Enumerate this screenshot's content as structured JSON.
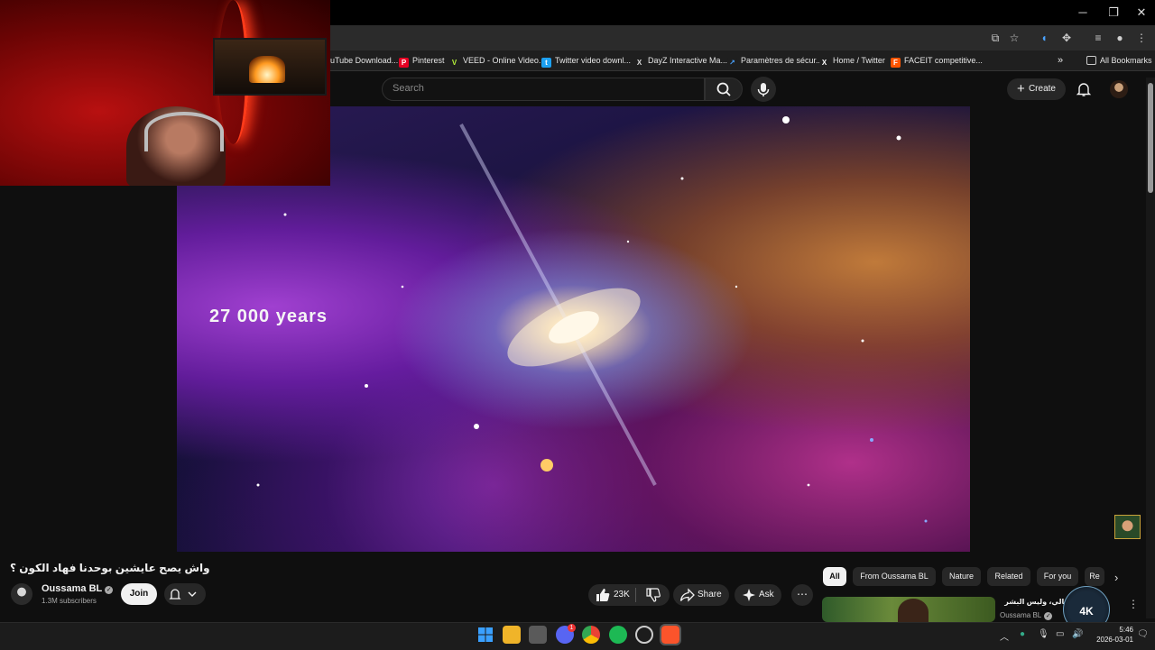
{
  "browser": {
    "window_controls": {
      "minimize": "─",
      "maximize": "❐",
      "close": "✕"
    },
    "bookmarks": [
      {
        "label": "uTube Download...",
        "icon_color": "#c00"
      },
      {
        "label": "Pinterest",
        "icon_color": "#e60023"
      },
      {
        "label": "VEED - Online Video...",
        "icon_color": "#b6f23a"
      },
      {
        "label": "Twitter video downl...",
        "icon_color": "#1da1f2"
      },
      {
        "label": "DayZ Interactive Ma...",
        "icon_color": "#333333"
      },
      {
        "label": "Paramètres de sécur...",
        "icon_color": "#1a73e8"
      },
      {
        "label": "Home / Twitter",
        "icon_color": "#000000"
      },
      {
        "label": "FACEIT competitive...",
        "icon_color": "#ff5500"
      }
    ],
    "bookmarks_overflow": "»",
    "all_bookmarks": "All Bookmarks"
  },
  "header": {
    "search_placeholder": "Search",
    "create_label": "Create"
  },
  "video": {
    "caption": "27 000 years",
    "title": "واش يصح عايشين بوحدنا فهاد الكون ؟",
    "channel": "Oussama BL",
    "subscribers": "1.3M subscribers",
    "join_label": "Join",
    "likes": "23K",
    "share_label": "Share",
    "ask_label": "Ask",
    "more": "⋯"
  },
  "chips": [
    "All",
    "From Oussama BL",
    "Nature",
    "Related",
    "For you",
    "Re"
  ],
  "recommendation": {
    "title": "! لم المالي، وليس البشر",
    "channel": "Oussama BL"
  },
  "overlay_logo": "4K",
  "taskbar": {
    "time": "5:46",
    "date": "2026-03-01",
    "discord_badge": "1"
  },
  "colors": {
    "background": "#0f0f0f",
    "accent": "#f1f1f1"
  }
}
